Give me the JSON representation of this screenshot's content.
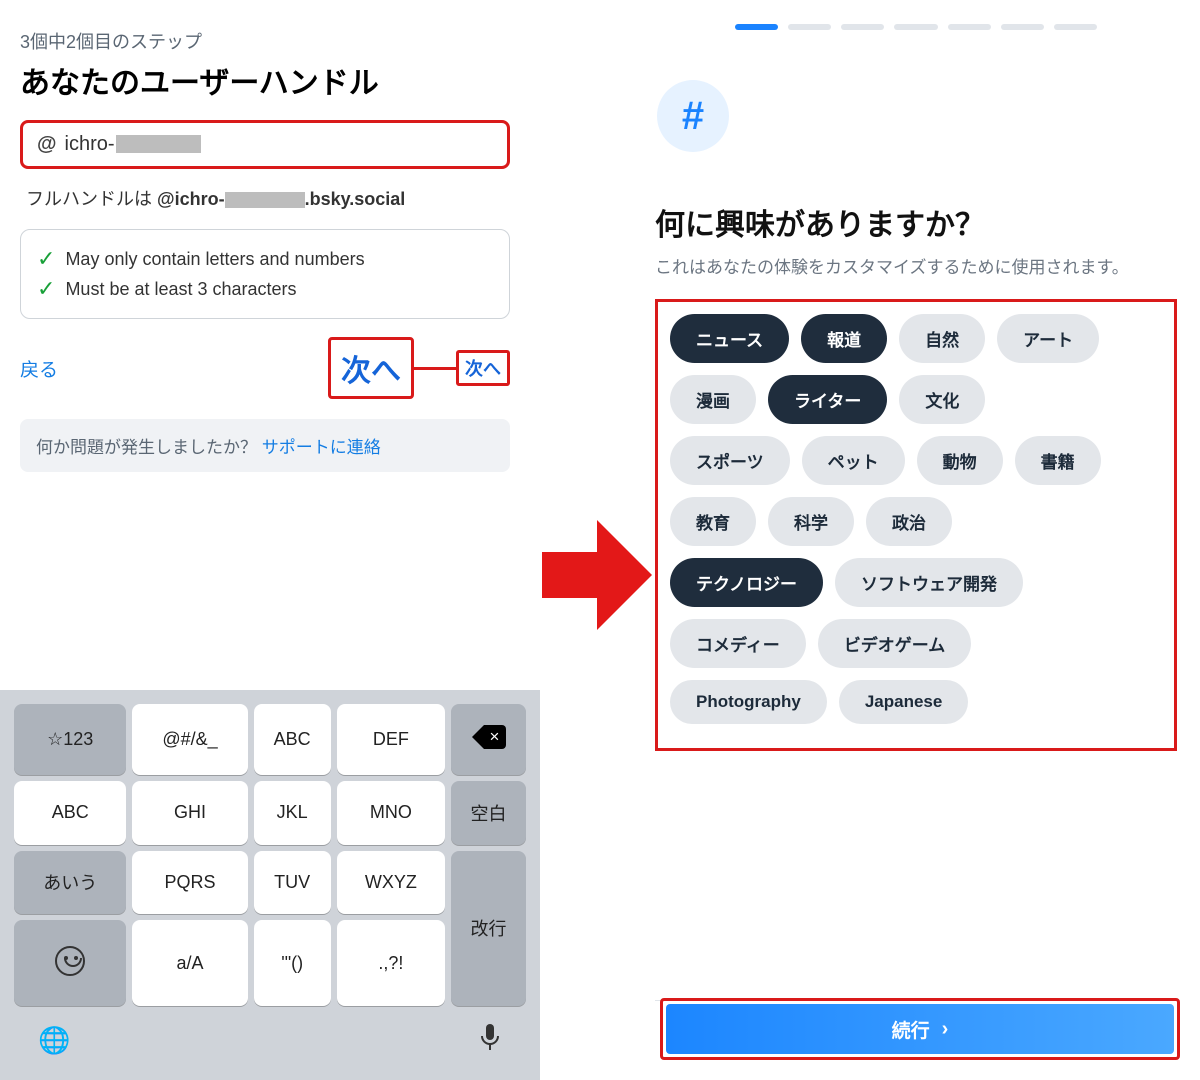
{
  "left": {
    "step_label": "3個中2個目のステップ",
    "title": "あなたのユーザーハンドル",
    "at_symbol": "@",
    "handle_prefix": "ichro-",
    "fullhandle_prefix": "フルハンドルは ",
    "fullhandle_bold_prefix": "@ichro-",
    "fullhandle_bold_suffix": ".bsky.social",
    "rule1": "May only contain letters and numbers",
    "rule2": "Must be at least 3 characters",
    "back": "戻る",
    "next_big": "次へ",
    "next_small": "次へ",
    "support_q": "何か問題が発生しましたか？ ",
    "support_link": "サポートに連絡"
  },
  "keyboard": {
    "row1": [
      "☆123",
      "@#/&_",
      "ABC",
      "DEF"
    ],
    "row2": [
      "ABC",
      "GHI",
      "JKL",
      "MNO",
      "空白"
    ],
    "row3": [
      "あいう",
      "PQRS",
      "TUV",
      "WXYZ"
    ],
    "row4_cells": [
      "a/A",
      "'\"()",
      ".,?!"
    ],
    "enter": "改行"
  },
  "right": {
    "progress_active_index": 0,
    "progress_total": 7,
    "hash": "#",
    "title": "何に興味がありますか？",
    "subtitle": "これはあなたの体験をカスタマイズするために使用されます。",
    "tags": [
      {
        "label": "ニュース",
        "selected": true
      },
      {
        "label": "報道",
        "selected": true
      },
      {
        "label": "自然",
        "selected": false
      },
      {
        "label": "アート",
        "selected": false
      },
      {
        "label": "漫画",
        "selected": false
      },
      {
        "label": "ライター",
        "selected": true
      },
      {
        "label": "文化",
        "selected": false
      },
      {
        "label": "スポーツ",
        "selected": false
      },
      {
        "label": "ペット",
        "selected": false
      },
      {
        "label": "動物",
        "selected": false
      },
      {
        "label": "書籍",
        "selected": false
      },
      {
        "label": "教育",
        "selected": false
      },
      {
        "label": "科学",
        "selected": false
      },
      {
        "label": "政治",
        "selected": false
      },
      {
        "label": "テクノロジー",
        "selected": true
      },
      {
        "label": "ソフトウェア開発",
        "selected": false
      },
      {
        "label": "コメディー",
        "selected": false
      },
      {
        "label": "ビデオゲーム",
        "selected": false
      },
      {
        "label": "Photography",
        "selected": false
      },
      {
        "label": "Japanese",
        "selected": false
      }
    ],
    "continue": "続行"
  },
  "tag_rows": [
    [
      0,
      1,
      2,
      3
    ],
    [
      4,
      5,
      6
    ],
    [
      7,
      8,
      9,
      10
    ],
    [
      11,
      12,
      13
    ],
    [
      14,
      15
    ],
    [
      16,
      17
    ],
    [
      18,
      19
    ]
  ]
}
